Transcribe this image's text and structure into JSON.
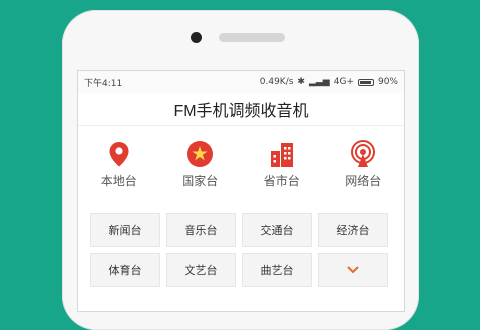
{
  "status": {
    "time": "下午4:11",
    "speed": "0.49K/s",
    "network": "4G+",
    "battery": "90%"
  },
  "app": {
    "title": "FM手机调频收音机"
  },
  "categories": [
    {
      "label": "本地台",
      "icon": "location-pin-icon"
    },
    {
      "label": "国家台",
      "icon": "china-flag-icon"
    },
    {
      "label": "省市台",
      "icon": "buildings-icon"
    },
    {
      "label": "网络台",
      "icon": "broadcast-icon"
    }
  ],
  "stations": [
    "新闻台",
    "音乐台",
    "交通台",
    "经济台",
    "体育台",
    "文艺台",
    "曲艺台"
  ],
  "expand_icon": "chevron-down-icon",
  "colors": {
    "background": "#17a68a",
    "accent": "#e03c2f"
  }
}
